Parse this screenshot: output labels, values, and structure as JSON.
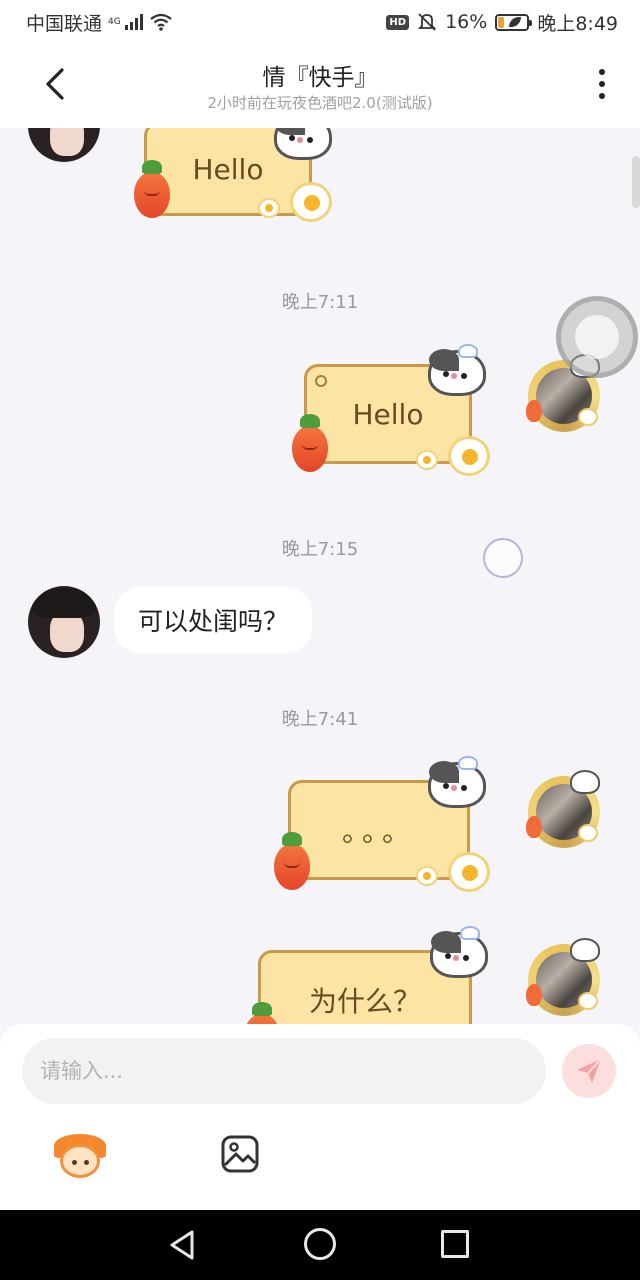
{
  "status_bar": {
    "carrier": "中国联通",
    "network": "4G",
    "battery": "16%",
    "time": "晚上8:49",
    "hd_label": "HD"
  },
  "header": {
    "title": "情『快手』",
    "subtitle": "2小时前在玩夜色酒吧2.0(测试版)"
  },
  "messages": [
    {
      "side": "left",
      "kind": "sticker",
      "text": "Hello"
    },
    {
      "timestamp": "晚上7:11"
    },
    {
      "side": "right",
      "kind": "sticker",
      "text": "Hello"
    },
    {
      "timestamp": "晚上7:15"
    },
    {
      "side": "left",
      "kind": "text",
      "text": "可以处闺吗？"
    },
    {
      "timestamp": "晚上7:41"
    },
    {
      "side": "right",
      "kind": "sticker",
      "text": "。。。"
    },
    {
      "side": "right",
      "kind": "sticker",
      "text": "为什么？"
    }
  ],
  "input": {
    "placeholder": "请输入..."
  },
  "colors": {
    "background": "#f5f4f9",
    "sticker_fill": "#fbe4a4",
    "sticker_border": "#c99a4a",
    "send_button": "#fcdede",
    "send_icon": "#f2a3a3"
  },
  "icons": {
    "back": "chevron-left-icon",
    "more": "more-vertical-icon",
    "send": "paper-plane-icon",
    "emoji": "mascot-icon",
    "image": "image-icon"
  }
}
